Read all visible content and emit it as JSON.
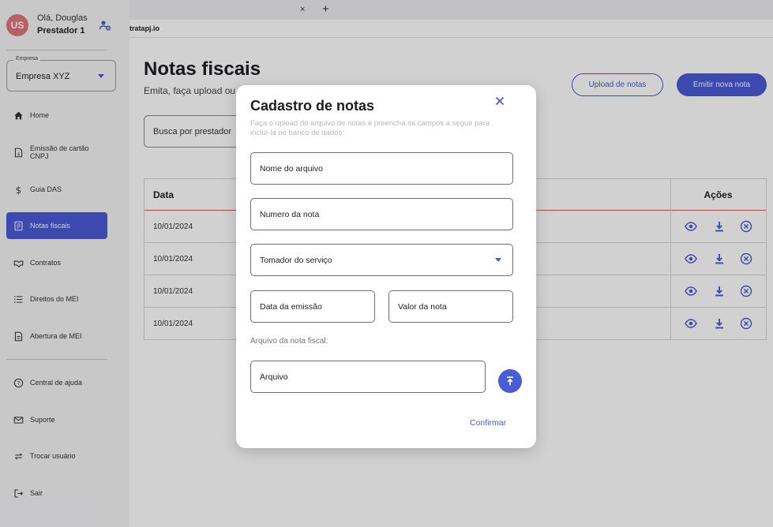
{
  "browser": {
    "tab_close": "×",
    "new_tab": "+",
    "url": "tratapj.io"
  },
  "user": {
    "initials": "US",
    "greeting": "Olá, Douglas",
    "role": "Prestador 1",
    "avatar_color": "#e0747a"
  },
  "company": {
    "legend": "Empresa",
    "value": "Empresa XYZ"
  },
  "nav": {
    "items": [
      {
        "label": "Home",
        "icon": "home-icon"
      },
      {
        "label": "Emissão de cartão CNPJ",
        "icon": "card-document-icon"
      },
      {
        "label": "Guia DAS",
        "icon": "dollar-icon"
      },
      {
        "label": "Notas fiscais",
        "icon": "receipt-icon",
        "active": true
      },
      {
        "label": "Contratos",
        "icon": "handshake-icon"
      },
      {
        "label": "Direitos do MEI",
        "icon": "list-icon"
      },
      {
        "label": "Abertura de MEI",
        "icon": "store-icon"
      }
    ],
    "bottom": [
      {
        "label": "Central de ajuda",
        "icon": "help-icon"
      },
      {
        "label": "Suporte",
        "icon": "mail-icon"
      },
      {
        "label": "Trocar usuário",
        "icon": "swap-icon"
      },
      {
        "label": "Sair",
        "icon": "logout-icon"
      }
    ]
  },
  "page": {
    "title": "Notas fiscais",
    "subtitle": "Emita, faça upload ou",
    "upload_button": "Upload de notas",
    "emit_button": "Emitir nova nota",
    "search_placeholder": "Busca por prestador"
  },
  "table": {
    "columns": {
      "date": "Data",
      "actions": "Ações"
    },
    "rows": [
      {
        "date": "10/01/2024"
      },
      {
        "date": "10/01/2024"
      },
      {
        "date": "10/01/2024"
      },
      {
        "date": "10/01/2024"
      }
    ]
  },
  "modal": {
    "title": "Cadastro de notas",
    "description": "Faça o upload do arquivo de notas e preencha os campos a seguir para incluí-la no banco de dados:",
    "fields": {
      "file_name": "Nome do arquivo",
      "note_number": "Numero da nota",
      "service_taker": "Tomador do serviço",
      "issue_date": "Data da emissão",
      "note_value": "Valor da nota"
    },
    "file_label": "Arquivo da nota fiscal:",
    "file_field": "Arquivo",
    "confirm": "Confirmar"
  },
  "colors": {
    "accent": "#4a5bd6",
    "divider": "#e05757"
  }
}
